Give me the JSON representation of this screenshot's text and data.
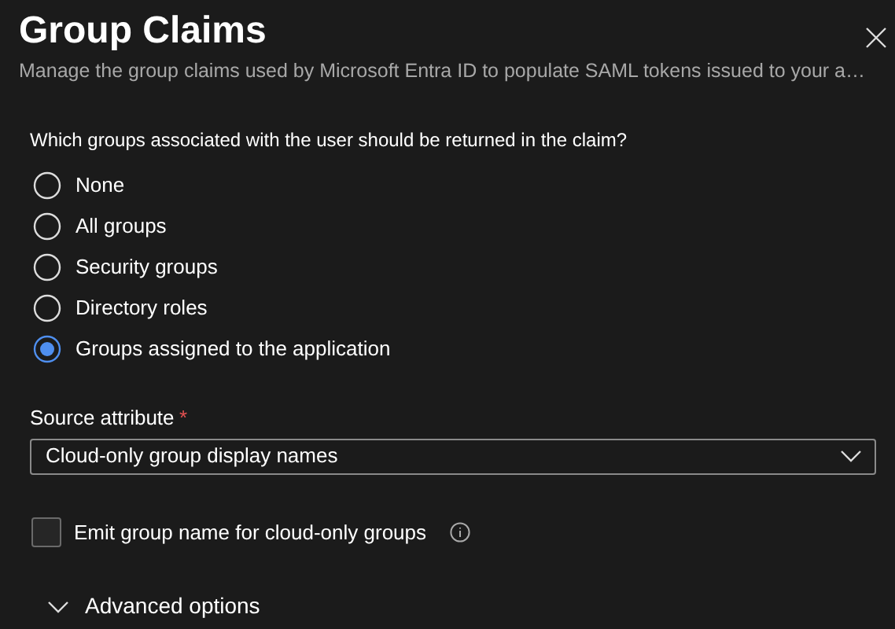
{
  "panel": {
    "title": "Group Claims",
    "subtitle": "Manage the group claims used by Microsoft Entra ID to populate SAML tokens issued to your a…"
  },
  "question": "Which groups associated with the user should be returned in the claim?",
  "options": [
    {
      "label": "None",
      "selected": false
    },
    {
      "label": "All groups",
      "selected": false
    },
    {
      "label": "Security groups",
      "selected": false
    },
    {
      "label": "Directory roles",
      "selected": false
    },
    {
      "label": "Groups assigned to the application",
      "selected": true
    }
  ],
  "source_attribute": {
    "label": "Source attribute",
    "required": true,
    "required_mark": "*",
    "value": "Cloud-only group display names"
  },
  "emit_checkbox": {
    "label": "Emit group name for cloud-only groups",
    "checked": false
  },
  "advanced": {
    "label": "Advanced options",
    "expanded": false
  }
}
